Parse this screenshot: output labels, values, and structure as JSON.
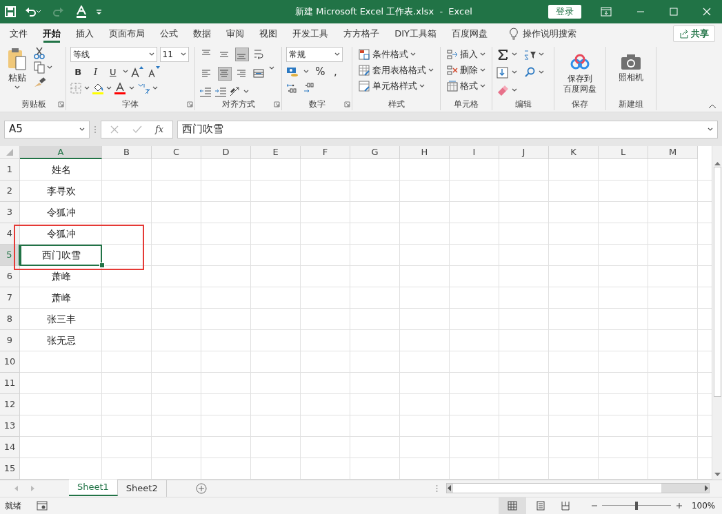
{
  "title_bar": {
    "title": "新建 Microsoft Excel 工作表.xlsx  -  Excel",
    "login": "登录",
    "redo_disabled": true
  },
  "menu_tabs": [
    {
      "label": "文件",
      "selected": false
    },
    {
      "label": "开始",
      "selected": true
    },
    {
      "label": "插入",
      "selected": false
    },
    {
      "label": "页面布局",
      "selected": false
    },
    {
      "label": "公式",
      "selected": false
    },
    {
      "label": "数据",
      "selected": false
    },
    {
      "label": "审阅",
      "selected": false
    },
    {
      "label": "视图",
      "selected": false
    },
    {
      "label": "开发工具",
      "selected": false
    },
    {
      "label": "方方格子",
      "selected": false
    },
    {
      "label": "DIY工具箱",
      "selected": false
    },
    {
      "label": "百度网盘",
      "selected": false
    }
  ],
  "tell_me": "操作说明搜索",
  "share": "共享",
  "ribbon_groups": [
    {
      "kind": "clipboard",
      "label": "剪贴板",
      "launcher": true,
      "paste": "粘贴"
    },
    {
      "kind": "font",
      "label": "字体",
      "launcher": true,
      "font": "等线",
      "size": "11",
      "styles": [
        "B",
        "I",
        "U"
      ]
    },
    {
      "kind": "alignment",
      "label": "对齐方式",
      "launcher": true,
      "buttons": [
        {
          "kind": "align-top",
          "selected": false
        },
        {
          "kind": "align-middle",
          "selected": false
        },
        {
          "kind": "align-bottom",
          "selected": true
        },
        {
          "kind": "wrap",
          "selected": false
        },
        {
          "kind": "align-left",
          "selected": false
        },
        {
          "kind": "align-center",
          "selected": true
        },
        {
          "kind": "align-right",
          "selected": false
        },
        {
          "kind": "merge",
          "selected": false
        }
      ]
    },
    {
      "kind": "number",
      "label": "数字",
      "launcher": true,
      "format": "常规",
      "symbols": [
        "%",
        ","
      ]
    },
    {
      "kind": "commands",
      "label": "样式",
      "commands": [
        {
          "kind": "conditional",
          "label": "条件格式"
        },
        {
          "kind": "table",
          "label": "套用表格格式"
        },
        {
          "kind": "cellstyle",
          "label": "单元格样式"
        }
      ]
    },
    {
      "kind": "commands",
      "label": "单元格",
      "commands": [
        {
          "kind": "insert",
          "label": "插入"
        },
        {
          "kind": "delete",
          "label": "删除"
        },
        {
          "kind": "format",
          "label": "格式"
        }
      ]
    },
    {
      "kind": "editing",
      "label": "编辑"
    },
    {
      "kind": "cloud-save",
      "label": "保存",
      "lines": [
        "保存到",
        "百度网盘"
      ]
    },
    {
      "kind": "camera",
      "label": "新建组",
      "lines": [
        "照相机"
      ]
    }
  ],
  "formula_bar": {
    "name_box": "A5",
    "fx": "fx",
    "value": "西门吹雪"
  },
  "columns": [
    "A",
    "B",
    "C",
    "D",
    "E",
    "F",
    "G",
    "H",
    "I",
    "J",
    "K",
    "L",
    "M"
  ],
  "rows": [
    {
      "number": "1",
      "value": "姓名",
      "selected": false
    },
    {
      "number": "2",
      "value": "李寻欢",
      "selected": false
    },
    {
      "number": "3",
      "value": "令狐冲",
      "selected": false
    },
    {
      "number": "4",
      "value": "令狐冲",
      "selected": false
    },
    {
      "number": "5",
      "value": "西门吹雪",
      "selected": true
    },
    {
      "number": "6",
      "value": "萧峰",
      "selected": false
    },
    {
      "number": "7",
      "value": "萧峰",
      "selected": false
    },
    {
      "number": "8",
      "value": "张三丰",
      "selected": false
    },
    {
      "number": "9",
      "value": "张无忌",
      "selected": false
    },
    {
      "number": "10",
      "selected": false
    },
    {
      "number": "11",
      "selected": false
    },
    {
      "number": "12",
      "selected": false
    },
    {
      "number": "13",
      "selected": false
    },
    {
      "number": "14",
      "selected": false
    },
    {
      "number": "15",
      "selected": false
    }
  ],
  "highlight": {
    "kind": "rectangle"
  },
  "sheets": [
    {
      "label": "Sheet1",
      "selected": true
    },
    {
      "label": "Sheet2",
      "selected": false
    }
  ],
  "status_bar": {
    "status": "就绪",
    "zoom": "100%"
  },
  "zoom_slider": {
    "level": 0.5
  }
}
